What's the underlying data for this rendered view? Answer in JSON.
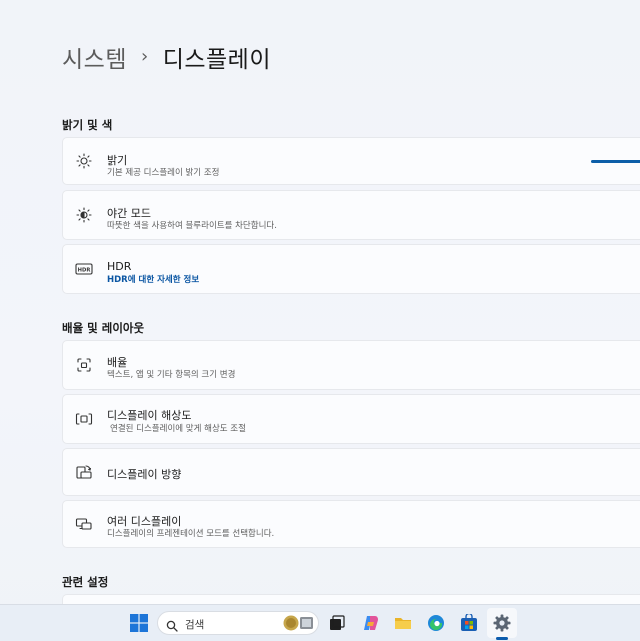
{
  "breadcrumb": {
    "parent": "시스템",
    "separator": "›",
    "current": "디스플레이"
  },
  "sections": {
    "brightness_color": "밝기 및 색",
    "scale_layout": "배율 및 레이아웃",
    "related": "관련 설정"
  },
  "cards": {
    "brightness": {
      "title": "밝기",
      "subtitle": "기본 제공 디스플레이 밝기 조정",
      "icon": "sun-icon",
      "level": 1.0
    },
    "night_light": {
      "title": "야간 모드",
      "subtitle": "따뜻한 색을 사용하여 블루라이트를 차단합니다.",
      "icon": "night-light-icon"
    },
    "hdr": {
      "title": "HDR",
      "link": "HDR에 대한 자세한 정보",
      "icon": "hdr-icon"
    },
    "scale": {
      "title": "배율",
      "subtitle": "텍스트, 앱 및 기타 항목의 크기 변경",
      "icon": "scale-icon"
    },
    "resolution": {
      "title": "디스플레이 해상도",
      "subtitle": "연결된 디스플레이에 맞게 해상도 조절",
      "icon": "resolution-icon"
    },
    "orientation": {
      "title": "디스플레이 방향",
      "icon": "orientation-icon"
    },
    "multiple": {
      "title": "여러 디스플레이",
      "subtitle": "디스플레이의 프레젠테이션 모드를 선택합니다.",
      "icon": "multi-display-icon"
    }
  },
  "taskbar": {
    "search_label": "검색",
    "apps": [
      "windows-start-icon",
      "search-icon",
      "task-view-icon",
      "copilot-icon",
      "file-explorer-icon",
      "edge-icon",
      "store-icon",
      "settings-icon"
    ],
    "active_app": "settings-icon",
    "accent": "#0b5cad"
  },
  "colors": {
    "accent": "#0c5ea8",
    "link": "#0b56a3"
  }
}
